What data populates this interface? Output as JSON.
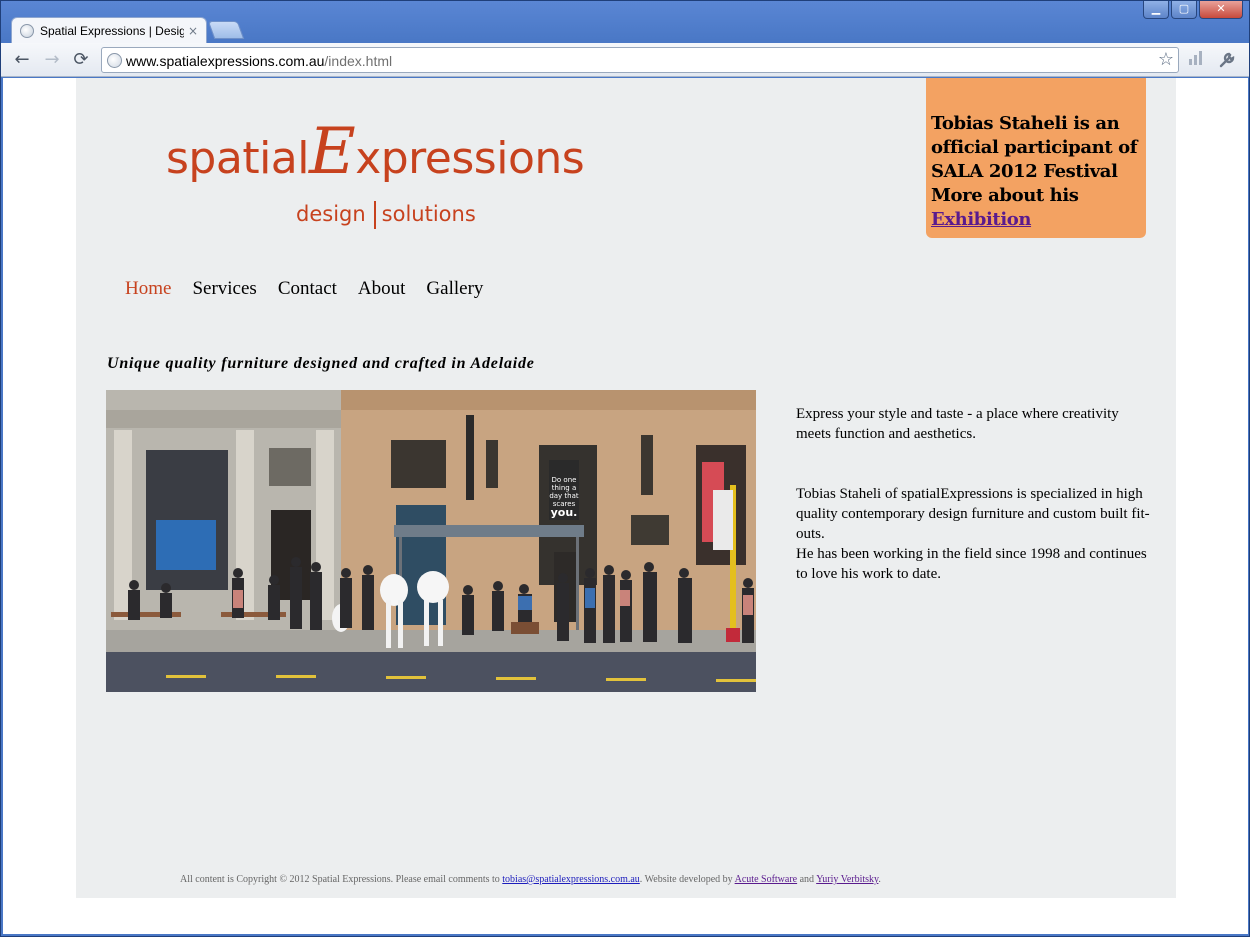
{
  "browser": {
    "tab_title": "Spatial Expressions | Design F",
    "tab_close": "×",
    "url_host": "www.spatialexpressions.com.au",
    "url_path": "/index.html",
    "win_minimize": "▁",
    "win_maximize": "▢",
    "win_close": "✕",
    "back_glyph": "←",
    "forward_glyph": "→",
    "reload_glyph": "⟳",
    "star_glyph": "☆",
    "wrench_glyph": "🔧"
  },
  "logo": {
    "part1": "spatial",
    "part2": "E",
    "part3": "xpressions",
    "sub1": "design",
    "sub2": "solutions"
  },
  "promo": {
    "line1": "Tobias Staheli is an official participant of SALA 2012 Festival",
    "line2_prefix": "More about his ",
    "link": "Exhibition"
  },
  "nav": {
    "items": [
      {
        "label": "Home"
      },
      {
        "label": "Services"
      },
      {
        "label": "Contact"
      },
      {
        "label": "About"
      },
      {
        "label": "Gallery"
      }
    ]
  },
  "tagline": "Unique quality furniture designed and crafted in Adelaide",
  "intro": {
    "p1": "Express your style and taste - a place where creativity meets function and aesthetics.",
    "p2": "Tobias Staheli of spatialExpressions is specialized in high quality contemporary design furniture and custom built fit-outs.",
    "p3": "He has been working in the field since 1998 and continues to love his work to date."
  },
  "hero_sign_text": "Do one thing a day that scares you.",
  "footer": {
    "prefix": "All content is Copyright © 2012 Spatial Expressions. Please email comments to ",
    "email": "tobias@spatialexpressions.com.au",
    "mid": ". Website developed by ",
    "dev1": "Acute Software",
    "and": " and ",
    "dev2": "Yuriy Verbitsky",
    "end": "."
  },
  "colors": {
    "brand": "#c7421e",
    "page_bg": "#eceeef",
    "promo_bg": "#f3a262",
    "visited_link": "#5a1b8e",
    "link": "#1d1dbd"
  }
}
